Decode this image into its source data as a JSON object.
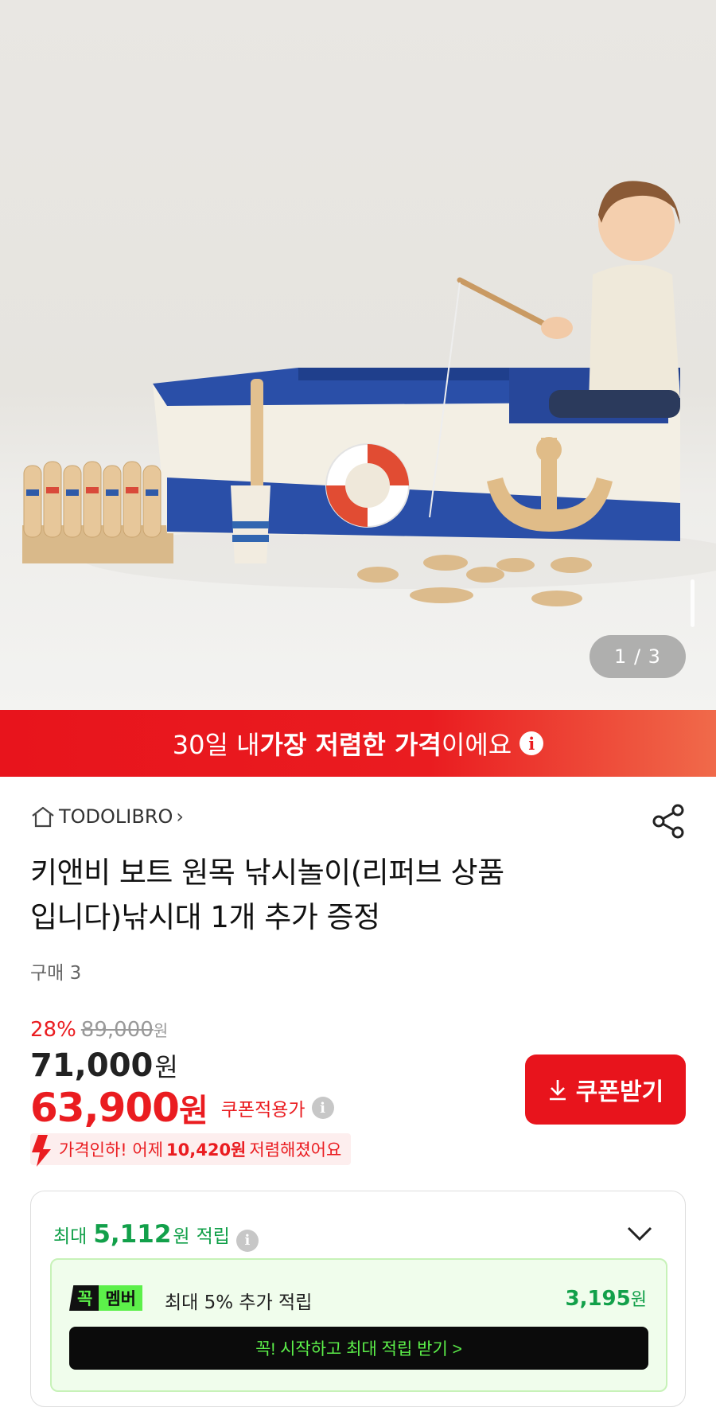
{
  "gallery": {
    "page_indicator": "1 / 3"
  },
  "promo": {
    "prefix": "30일 내 ",
    "highlight": "가장 저렴한 가격",
    "suffix": "이에요"
  },
  "product": {
    "brand": "TODOLIBRO",
    "title_line1": "키앤비 보트 원목 낚시놀이(리퍼브 상품",
    "title_line2": "입니다)낚시대 1개 추가 증정",
    "buy_count": "구매 3",
    "discount_rate": "28%",
    "original_price": "89,000",
    "original_unit": "원",
    "price": "71,000",
    "price_unit": "원",
    "coupon_price": "63,900",
    "coupon_price_unit": "원",
    "coupon_label": "쿠폰적용가",
    "coupon_button": "쿠폰받기",
    "price_drop_prefix": "가격인하! 어제",
    "price_drop_amount": "10,420원",
    "price_drop_suffix": "저렴해졌어요"
  },
  "reward": {
    "prefix": "최대",
    "amount": "5,112",
    "unit": "원",
    "suffix": "적립",
    "member_tag_k": "꼭",
    "member_tag_m": "멤버",
    "member_text": "최대 5% 추가 적립",
    "member_amount": "3,195",
    "member_unit": "원",
    "member_cta": "꼭! 시작하고 최대 적립 받기 >"
  },
  "colors": {
    "accent_red": "#e8141c",
    "reward_green": "#12a04a",
    "member_lime": "#5cf04a"
  },
  "icons": {
    "home": "home-icon",
    "share": "share-icon",
    "info": "info-icon",
    "download": "download-icon",
    "price_down": "down-arrow-icon",
    "expand": "chevron-down-icon"
  }
}
